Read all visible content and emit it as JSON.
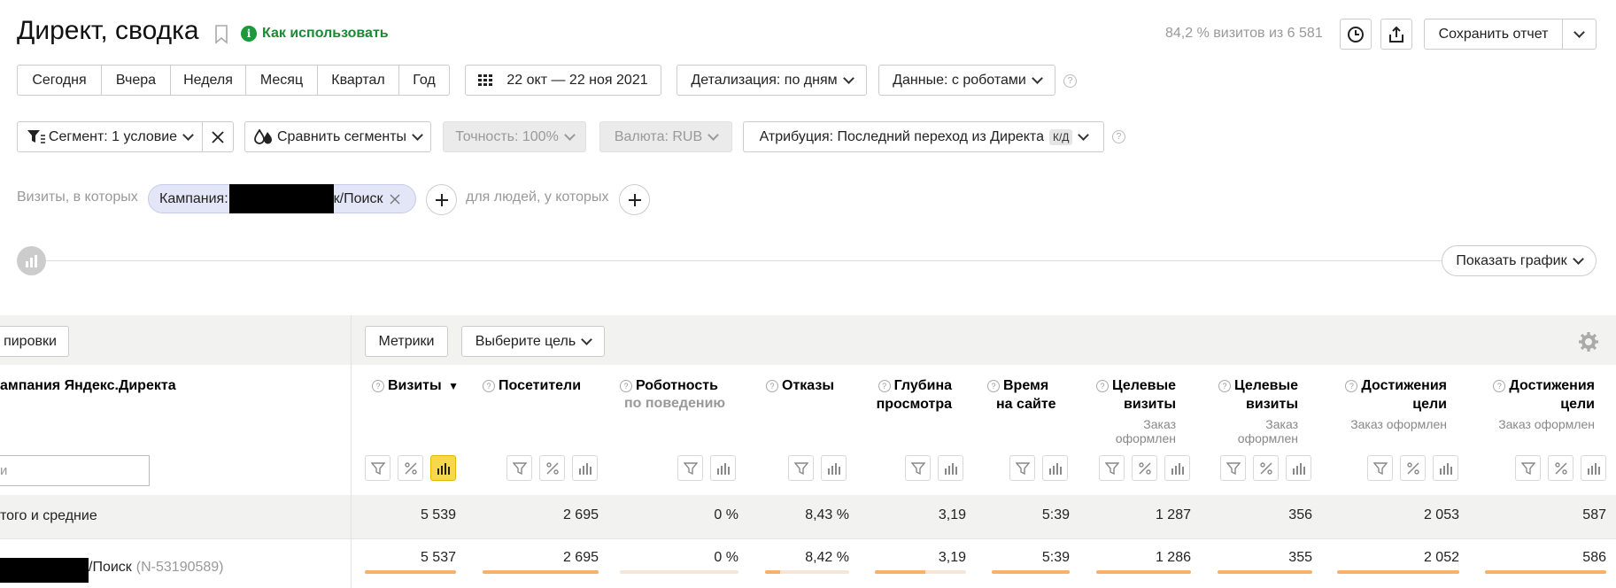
{
  "header": {
    "title": "Директ, сводка",
    "how_to": "Как использовать",
    "visits_share": "84,2 % визитов из 6 581",
    "save_report": "Сохранить отчет"
  },
  "periods": [
    "Сегодня",
    "Вчера",
    "Неделя",
    "Месяц",
    "Квартал",
    "Год"
  ],
  "date_range": "22 окт — 22 ноя 2021",
  "detail": "Детализация: по дням",
  "data_mode": "Данные: с роботами",
  "segment": "Сегмент: 1 условие",
  "compare": "Сравнить сегменты",
  "accuracy": "Точность: 100%",
  "currency": "Валюта: RUB",
  "attribution": "Атрибуция: Последний переход из Директа",
  "attribution_badge": "К/Д",
  "filter": {
    "visits_label": "Визиты, в которых",
    "chip_prefix": "Кампания:",
    "chip_suffix": "к/Поиск",
    "people_label": "для людей, у которых"
  },
  "show_chart": "Показать график",
  "groupings_button": "пировки",
  "metrics_button": "Метрики",
  "goal_select": "Выберите цель",
  "table": {
    "dimension_header": "ампания Яндекс.Директа",
    "search_placeholder": "и",
    "columns": [
      {
        "title": "Визиты",
        "sort": "▼"
      },
      {
        "title": "Посетители"
      },
      {
        "title": "Роботность",
        "subtitle": "по поведению"
      },
      {
        "title": "Отказы"
      },
      {
        "title": "Глубина",
        "title2": "просмотра"
      },
      {
        "title": "Время",
        "title2": "на сайте"
      },
      {
        "title": "Целевые",
        "title2": "визиты",
        "note1": "Заказ",
        "note2": "оформлен"
      },
      {
        "title": "Целевые",
        "title2": "визиты",
        "note1": "Заказ",
        "note2": "оформлен"
      },
      {
        "title": "Достижения",
        "title2": "цели",
        "note1": "Заказ оформлен"
      },
      {
        "title": "Достижения",
        "title2": "цели",
        "note1": "Заказ оформлен"
      }
    ],
    "totals": {
      "label": "того и средние",
      "values": [
        "5 539",
        "2 695",
        "0 %",
        "8,43 %",
        "3,19",
        "5:39",
        "1 287",
        "356",
        "2 053",
        "587"
      ]
    },
    "rows": [
      {
        "name": "/Поиск",
        "id": "(N-53190589)",
        "values": [
          "5 537",
          "2 695",
          "0 %",
          "8,42 %",
          "3,19",
          "5:39",
          "1 286",
          "355",
          "2 052",
          "586"
        ],
        "bar_fill": [
          1.0,
          1.0,
          0.0,
          0.18,
          0.55,
          1.0,
          1.0,
          1.0,
          1.0,
          1.0
        ]
      }
    ]
  },
  "colors": {
    "accent_green": "#1a9a3a",
    "chip_bg": "#e3e6f7",
    "bar": "#f6b26b",
    "active_icon": "#f7d84a"
  }
}
